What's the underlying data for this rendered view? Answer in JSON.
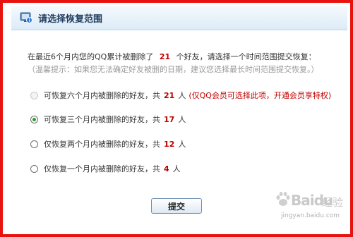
{
  "dialog": {
    "title": "请选择恢复范围",
    "intro": {
      "prefix": "在最近6个月内您的QQ累计被删除了",
      "count": "21",
      "suffix": "个好友，请选择一个时间范围提交恢复："
    },
    "hint": "（温馨提示：如果您无法确定好友被删的日期，建议您选择最长时间范围提交恢复。）",
    "options": [
      {
        "label": "可恢复六个月内被删除的好友，共",
        "count": "21",
        "unit": "人",
        "note": "(仅QQ会员可选择此项，开通会员享特权)",
        "disabled": true,
        "checked": false
      },
      {
        "label": "可恢复三个月内被删除的好友，共",
        "count": "17",
        "unit": "人",
        "note": "",
        "disabled": false,
        "checked": true
      },
      {
        "label": "仅恢复两个月内被删除的好友，共",
        "count": "12",
        "unit": "人",
        "note": "",
        "disabled": false,
        "checked": false
      },
      {
        "label": "仅恢复一个月内被删除的好友，共",
        "count": "4",
        "unit": "人",
        "note": "",
        "disabled": false,
        "checked": false
      }
    ],
    "submit_label": "提交"
  },
  "watermark": {
    "logo": "Baidu",
    "jingyan": "经验",
    "url": "jingyan.baidu.com"
  },
  "colors": {
    "frame_border": "#e8130e",
    "count_red": "#c00000",
    "titlebar": "#ddebf7"
  }
}
